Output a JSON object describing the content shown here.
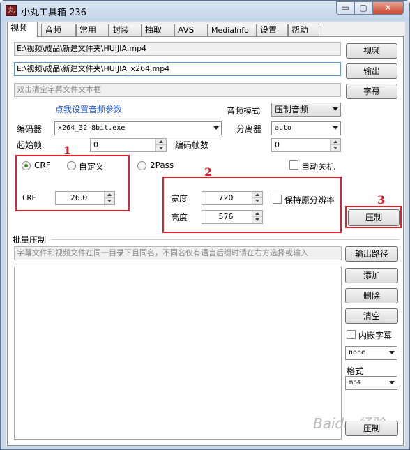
{
  "window": {
    "title": "小丸工具箱 236",
    "icon_glyph": "丸"
  },
  "titlebar_buttons": {
    "minimize": "▭",
    "maximize": "▢",
    "close": "✕"
  },
  "tabs": [
    "视频",
    "音频",
    "常用",
    "封装",
    "抽取",
    "AVS",
    "MediaInfo",
    "设置",
    "帮助"
  ],
  "files": {
    "video_path": "E:\\视频\\成品\\新建文件夹\\HUIJIA.mp4",
    "output_path": "E:\\视频\\成品\\新建文件夹\\HUIJIA_x264.mp4",
    "subtitle_placeholder": "双击清空字幕文件文本框",
    "video_button": "视频",
    "output_button": "输出",
    "subtitle_button": "字幕"
  },
  "audio": {
    "settings_link": "点我设置音频参数",
    "mode_label": "音频模式",
    "mode_value": "压制音频"
  },
  "encoder": {
    "label": "编码器",
    "value": "x264_32-8bit.exe",
    "demuxer_label": "分离器",
    "demuxer_value": "auto"
  },
  "frames": {
    "start_label": "起始帧",
    "start_value": "0",
    "count_label": "编码帧数",
    "count_value": "0"
  },
  "rate_control": {
    "crf_option": "CRF",
    "custom_option": "自定义",
    "twopass_option": "2Pass",
    "selected": "CRF",
    "crf_label": "CRF",
    "crf_value": "26.0"
  },
  "auto_shutdown": {
    "label": "自动关机",
    "checked": false
  },
  "resolution": {
    "width_label": "宽度",
    "width_value": "720",
    "height_label": "高度",
    "height_value": "576",
    "keep_label": "保持原分辨率",
    "keep_checked": false
  },
  "encode_button": "压制",
  "annotations": [
    "1",
    "2",
    "3"
  ],
  "batch": {
    "title": "批量压制",
    "hint": "字幕文件和视频文件在同一目录下且同名，不同名仅有语言后缀时请在右方选择或输入",
    "output_path_button": "输出路径",
    "add_button": "添加",
    "delete_button": "删除",
    "clear_button": "清空",
    "embed_sub_label": "内嵌字幕",
    "embed_sub_checked": false,
    "sub_select_value": "none",
    "format_label": "格式",
    "format_value": "mp4",
    "encode_button": "压制"
  },
  "watermark": "Baidu 经验",
  "colors": {
    "annotation_red": "#e0202a",
    "link_blue": "#1f56c7",
    "radio_green": "#3c8a27"
  }
}
